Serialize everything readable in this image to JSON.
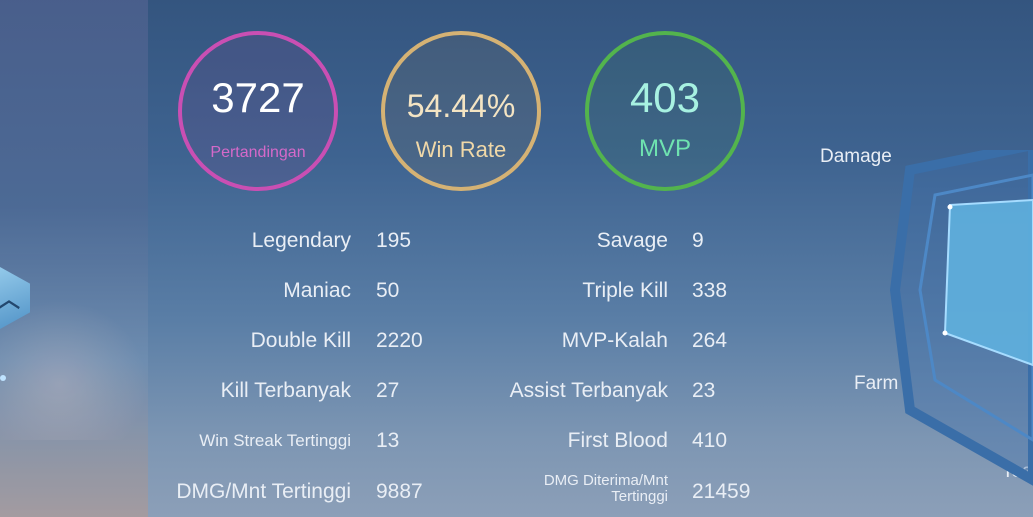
{
  "summary": {
    "matches": {
      "value": "3727",
      "label": "Pertandingan"
    },
    "win_rate": {
      "value": "54.44%",
      "label": "Win Rate"
    },
    "mvp": {
      "value": "403",
      "label": "MVP"
    }
  },
  "stats_left": [
    {
      "label": "Legendary",
      "value": "195"
    },
    {
      "label": "Maniac",
      "value": "50"
    },
    {
      "label": "Double Kill",
      "value": "2220"
    },
    {
      "label": "Kill Terbanyak",
      "value": "27"
    },
    {
      "label": "Win Streak Tertinggi",
      "value": "13"
    },
    {
      "label": "DMG/Mnt Tertinggi",
      "value": "9887"
    }
  ],
  "stats_right": [
    {
      "label": "Savage",
      "value": "9"
    },
    {
      "label": "Triple Kill",
      "value": "338"
    },
    {
      "label": "MVP-Kalah",
      "value": "264"
    },
    {
      "label": "Assist Terbanyak",
      "value": "23"
    },
    {
      "label": "First Blood",
      "value": "410"
    },
    {
      "label_line1": "DMG Diterima/Mnt",
      "label_line2": "Tertinggi",
      "value": "21459"
    }
  ],
  "radar": {
    "labels": {
      "damage": "Damage",
      "farm": "Farm",
      "team": "Tea"
    }
  },
  "colors": {
    "matches_ring": "#c94fb3",
    "win_rate_ring": "#d5b274",
    "mvp_ring": "#53b44d"
  },
  "icons": {
    "nav": "chevron-up-icon"
  }
}
